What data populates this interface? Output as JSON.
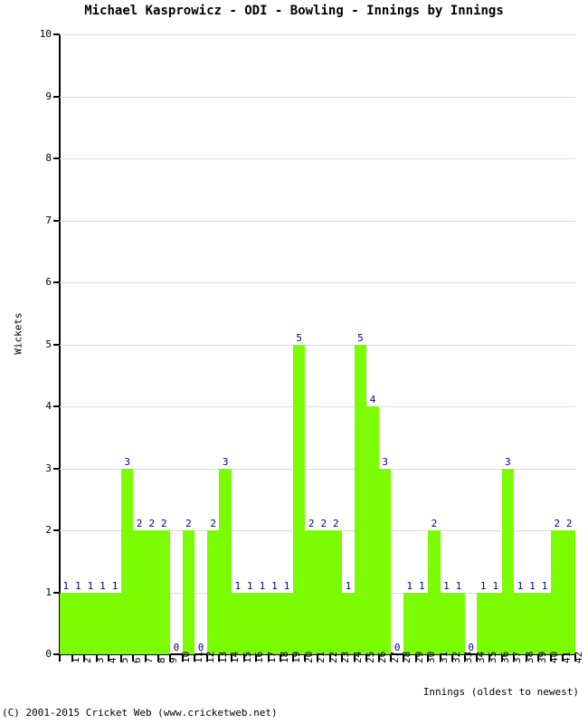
{
  "chart_data": {
    "type": "bar",
    "title": "Michael Kasprowicz - ODI - Bowling - Innings by Innings",
    "xlabel": "Innings (oldest to newest)",
    "ylabel": "Wickets",
    "ylim": [
      0,
      10
    ],
    "ytick_labels": [
      "0",
      "1",
      "2",
      "3",
      "4",
      "5",
      "6",
      "7",
      "8",
      "9",
      "10"
    ],
    "yticks": [
      0,
      1,
      2,
      3,
      4,
      5,
      6,
      7,
      8,
      9,
      10
    ],
    "grid": true,
    "legend": null,
    "bar_color": "#7CFC00",
    "label_color": "#00008B",
    "categories": [
      "1",
      "2",
      "3",
      "4",
      "5",
      "6",
      "7",
      "8",
      "9",
      "10",
      "11",
      "12",
      "13",
      "14",
      "15",
      "16",
      "17",
      "18",
      "19",
      "20",
      "21",
      "22",
      "23",
      "24",
      "25",
      "26",
      "27",
      "28",
      "29",
      "30",
      "31",
      "32",
      "33",
      "34",
      "35",
      "36",
      "37",
      "38",
      "39",
      "40",
      "41",
      "42"
    ],
    "values": [
      1,
      1,
      1,
      1,
      1,
      3,
      2,
      2,
      2,
      0,
      2,
      0,
      2,
      3,
      1,
      1,
      1,
      1,
      1,
      5,
      2,
      2,
      2,
      1,
      5,
      4,
      3,
      0,
      1,
      1,
      2,
      1,
      1,
      0,
      1,
      1,
      3,
      1,
      1,
      1,
      2,
      2
    ]
  },
  "footer": {
    "copyright": "(C) 2001-2015 Cricket Web (www.cricketweb.net)"
  }
}
